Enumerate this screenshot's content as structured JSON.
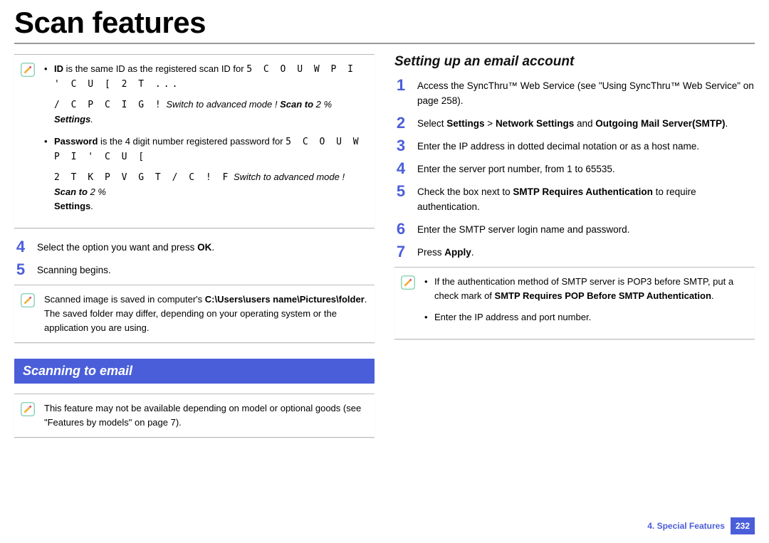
{
  "title": "Scan features",
  "left": {
    "note1": {
      "bullet1_pre": "ID",
      "bullet1_mid": " is the same ID as the registered scan ID for ",
      "bullet1_garble": "5 C O U W P I ' C U [  2 T ...",
      "bullet1_line2_g": "/ C P C I G !",
      "bullet1_line2_t": "      Switch to advanced mode  ! ",
      "bullet1_line2_scan": "Scan to",
      "bullet1_line2_rest": "  2 % ",
      "bullet1_line2_settings": "Settings",
      "bullet1_line2_dot": ".",
      "bullet2_pre": "Password",
      "bullet2_mid": " is the 4 digit number registered password for ",
      "bullet2_garble": "5 C O U W P I ' C U [",
      "bullet2_line2_g": "2 T K P V G T  / C ! F",
      "bullet2_line2_t": "     Switch to advanced mode  ! ",
      "bullet2_line2_scan": "Scan to",
      "bullet2_line2_rest": "  2 %",
      "bullet2_line3": "Settings",
      "bullet2_line3_dot": "."
    },
    "step4": "Select the option you want and press ",
    "step4_bold": "OK",
    "step4_dot": ".",
    "step5": "Scanning begins.",
    "note2_a": "Scanned image is saved in computer's ",
    "note2_b": "C:\\Users\\users name\\Pictures\\folder",
    "note2_c": ". The saved folder may differ, depending on your operating system or the application you are using.",
    "section": "Scanning to email",
    "note3": "This feature may not be available depending on model or optional goods (see \"Features by models\" on page 7)."
  },
  "right": {
    "heading": "Setting up an email account",
    "s1": "Access the SyncThru™ Web Service (see \"Using SyncThru™ Web Service\" on page 258).",
    "s2_a": "Select ",
    "s2_b": "Settings",
    "s2_c": " > ",
    "s2_d": "Network Settings",
    "s2_e": " and ",
    "s2_f": "Outgoing Mail Server(SMTP)",
    "s2_g": ".",
    "s3": "Enter the IP address in dotted decimal notation or as a host name.",
    "s4": "Enter the server port number, from 1 to 65535.",
    "s5_a": "Check the box next to ",
    "s5_b": "SMTP Requires Authentication",
    "s5_c": " to require authentication.",
    "s6": "Enter the SMTP server login name and password.",
    "s7_a": "Press ",
    "s7_b": "Apply",
    "s7_c": ".",
    "note_b1_a": "If the authentication method of SMTP server is POP3 before SMTP, put a check mark of ",
    "note_b1_b": "SMTP Requires POP Before SMTP Authentication",
    "note_b1_c": ".",
    "note_b2": "Enter the IP address and port number."
  },
  "footer": {
    "chapter": "4.  Special Features",
    "page": "232"
  },
  "nums": {
    "n1": "1",
    "n2": "2",
    "n3": "3",
    "n4": "4",
    "n5": "5",
    "n6": "6",
    "n7": "7"
  }
}
